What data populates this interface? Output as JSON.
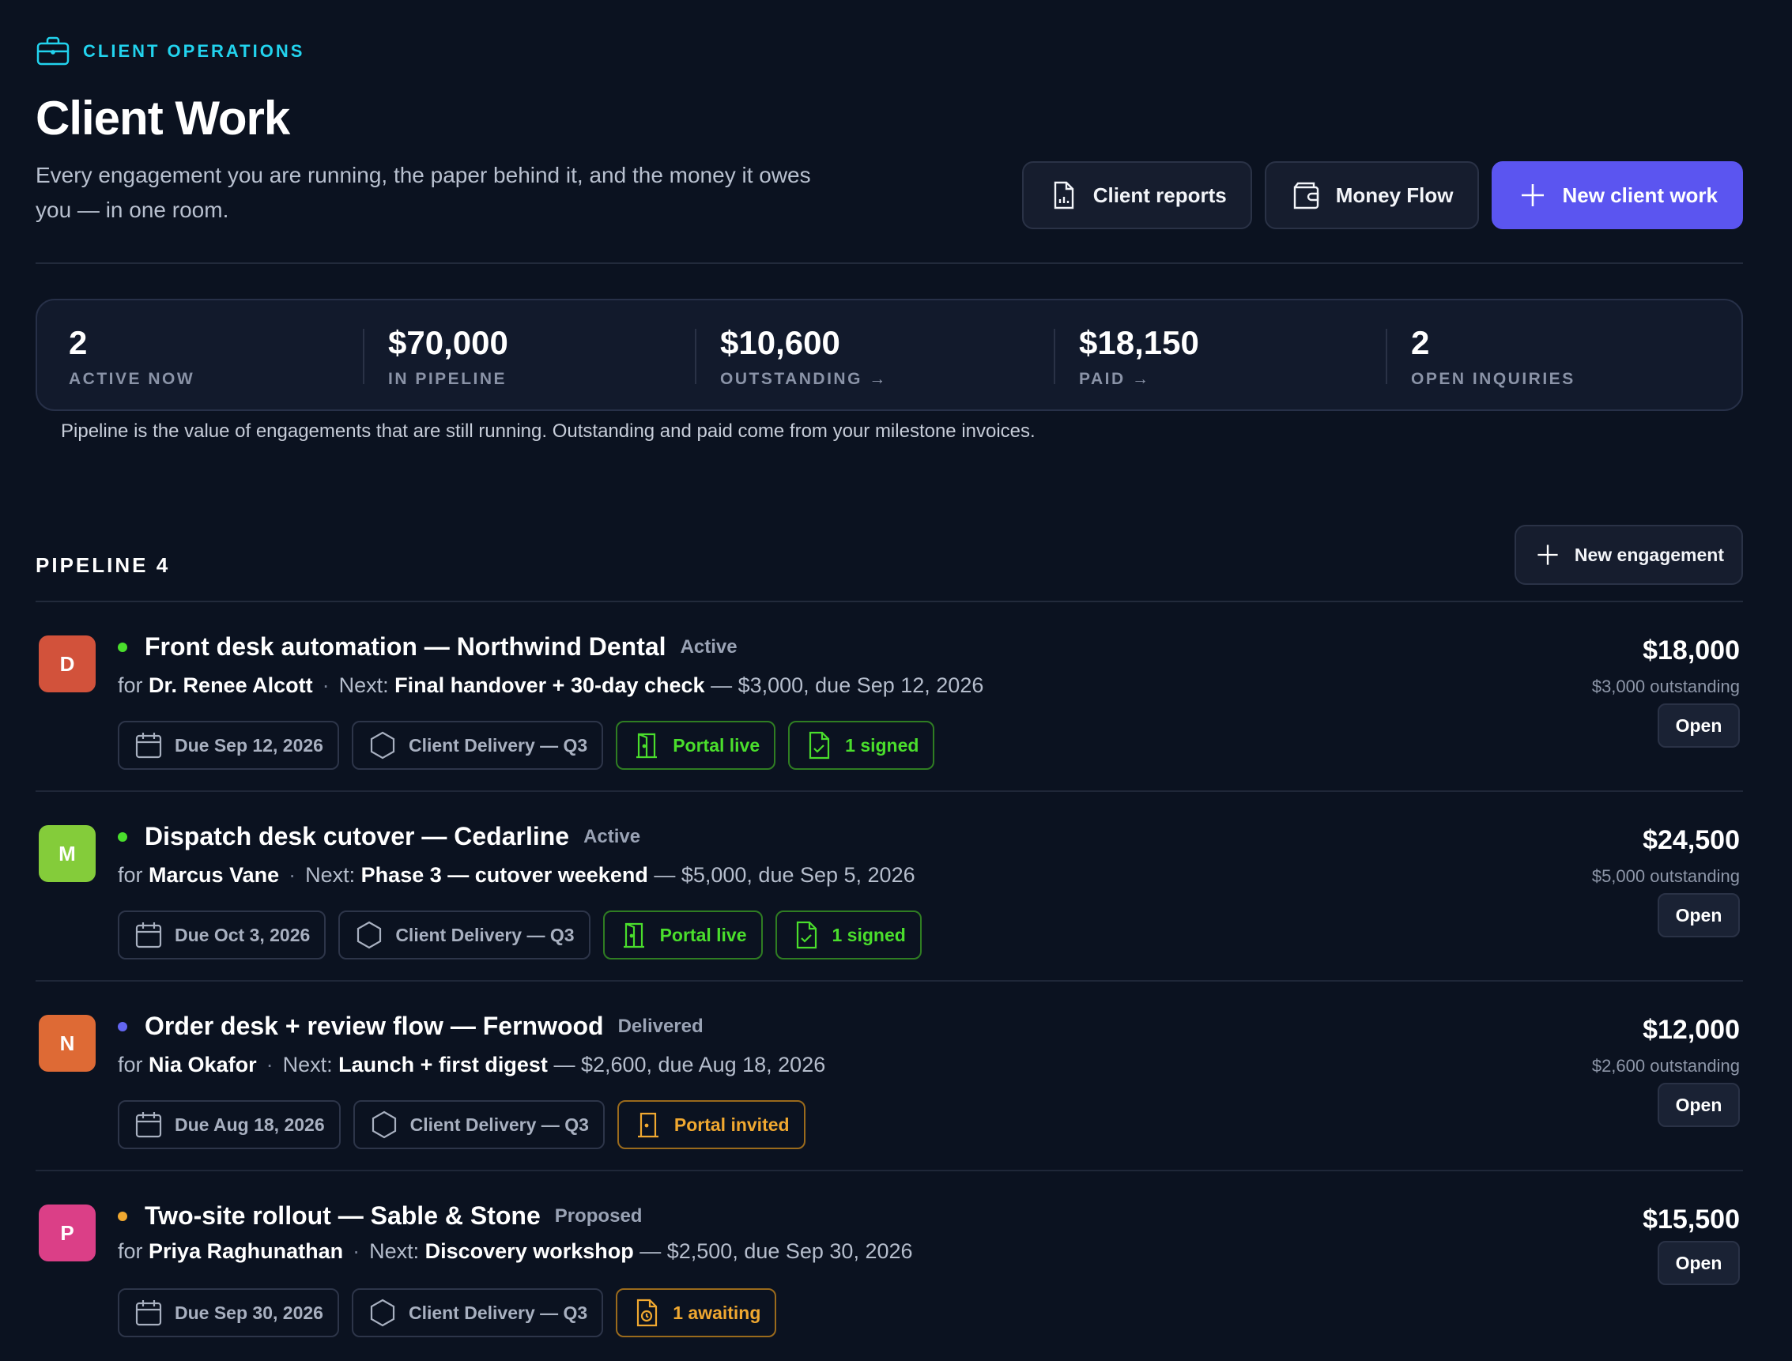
{
  "header": {
    "eyebrow": "CLIENT OPERATIONS",
    "eyebrow_icon": "briefcase-icon",
    "title": "Client Work",
    "subtitle": "Every engagement you are running, the paper behind it, and the money it owes you — in one room."
  },
  "actions": {
    "client_reports": "Client reports",
    "money_flow": "Money Flow",
    "new_client_work": "New client work"
  },
  "stats": [
    {
      "value": "2",
      "label": "ACTIVE NOW"
    },
    {
      "value": "$70,000",
      "label": "IN PIPELINE"
    },
    {
      "value": "$10,600",
      "label": "OUTSTANDING →"
    },
    {
      "value": "$18,150",
      "label": "PAID →"
    },
    {
      "value": "2",
      "label": "OPEN INQUIRIES"
    }
  ],
  "stats_note": "Pipeline is the value of engagements that are still running. Outstanding and paid come from your milestone invoices.",
  "pipeline": {
    "title": "PIPELINE",
    "count": "4",
    "new_button": "New engagement"
  },
  "colors": {
    "accent": "#5b55f0",
    "eyebrow": "#22d3ee",
    "active_dot": "#4ade2c",
    "delivered_dot": "#6366f1",
    "proposed_dot": "#f0a830"
  },
  "rows": [
    {
      "initial": "D",
      "avatar_color": "#d2523b",
      "dot_color": "#4ade2c",
      "name": "Front desk automation — Northwind Dental",
      "status": "Active",
      "for_label": "for",
      "client": "Dr. Renee Alcott",
      "next_label": "Next:",
      "next": "Final handover + 30-day check",
      "next_detail": "— $3,000, due Sep 12, 2026",
      "chips": {
        "due": "Due Sep 12, 2026",
        "project": "Client Delivery — Q3",
        "portal": "Portal live",
        "docs": "1 signed"
      },
      "amount": "$18,000",
      "outstanding": "$3,000 outstanding",
      "open": "Open"
    },
    {
      "initial": "M",
      "avatar_color": "#84cc3a",
      "dot_color": "#4ade2c",
      "name": "Dispatch desk cutover — Cedarline",
      "status": "Active",
      "for_label": "for",
      "client": "Marcus Vane",
      "next_label": "Next:",
      "next": "Phase 3 — cutover weekend",
      "next_detail": "— $5,000, due Sep 5, 2026",
      "chips": {
        "due": "Due Oct 3, 2026",
        "project": "Client Delivery — Q3",
        "portal": "Portal live",
        "docs": "1 signed"
      },
      "amount": "$24,500",
      "outstanding": "$5,000 outstanding",
      "open": "Open"
    },
    {
      "initial": "N",
      "avatar_color": "#de6a35",
      "dot_color": "#6366f1",
      "name": "Order desk + review flow — Fernwood",
      "status": "Delivered",
      "for_label": "for",
      "client": "Nia Okafor",
      "next_label": "Next:",
      "next": "Launch + first digest",
      "next_detail": "— $2,600, due Aug 18, 2026",
      "chips": {
        "due": "Due Aug 18, 2026",
        "project": "Client Delivery — Q3",
        "portal": "Portal invited"
      },
      "amount": "$12,000",
      "outstanding": "$2,600 outstanding",
      "open": "Open"
    },
    {
      "initial": "P",
      "avatar_color": "#db3f87",
      "dot_color": "#f0a830",
      "name": "Two-site rollout — Sable & Stone",
      "status": "Proposed",
      "for_label": "for",
      "client": "Priya Raghunathan",
      "next_label": "Next:",
      "next": "Discovery workshop",
      "next_detail": "— $2,500, due Sep 30, 2026",
      "chips": {
        "due": "Due Sep 30, 2026",
        "project": "Client Delivery — Q3",
        "docs": "1 awaiting"
      },
      "amount": "$15,500",
      "outstanding": "",
      "open": "Open"
    }
  ]
}
